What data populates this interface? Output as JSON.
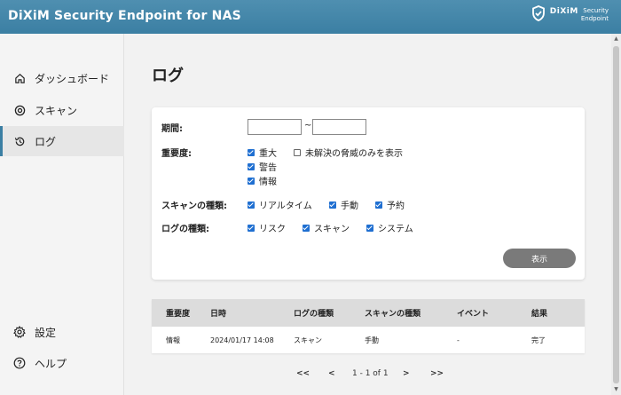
{
  "app": {
    "title": "DiXiM Security Endpoint for NAS"
  },
  "brand": {
    "name": "DiXiM",
    "sub1": "Security",
    "sub2": "Endpoint",
    "icon": "shield-check-icon"
  },
  "sidebar": {
    "items": [
      {
        "label": "ダッシュボード",
        "icon": "home-icon"
      },
      {
        "label": "スキャン",
        "icon": "scan-icon"
      },
      {
        "label": "ログ",
        "icon": "history-icon",
        "active": true
      }
    ],
    "bottom": [
      {
        "label": "設定",
        "icon": "gear-icon"
      },
      {
        "label": "ヘルプ",
        "icon": "help-icon"
      }
    ]
  },
  "main": {
    "title": "ログ"
  },
  "filter": {
    "period_label": "期間:",
    "period_from": "",
    "period_to": "",
    "period_sep": "~",
    "severity_label": "重要度:",
    "severity": [
      {
        "label": "重大",
        "checked": true
      },
      {
        "label": "警告",
        "checked": true
      },
      {
        "label": "情報",
        "checked": true
      }
    ],
    "unresolved": {
      "label": "未解決の脅威のみを表示",
      "checked": false
    },
    "scan_type_label": "スキャンの種類:",
    "scan_types": [
      {
        "label": "リアルタイム",
        "checked": true
      },
      {
        "label": "手動",
        "checked": true
      },
      {
        "label": "予約",
        "checked": true
      }
    ],
    "log_type_label": "ログの種類:",
    "log_types": [
      {
        "label": "リスク",
        "checked": true
      },
      {
        "label": "スキャン",
        "checked": true
      },
      {
        "label": "システム",
        "checked": true
      }
    ],
    "show_button": "表示"
  },
  "table": {
    "headers": [
      "重要度",
      "日時",
      "ログの種類",
      "スキャンの種類",
      "イベント",
      "結果"
    ],
    "rows": [
      [
        "情報",
        "2024/01/17 14:08",
        "スキャン",
        "手動",
        "-",
        "完了"
      ]
    ]
  },
  "pager": {
    "first": "<<",
    "prev": "<",
    "info": "1 - 1 of 1",
    "next": ">",
    "last": ">>"
  },
  "colors": {
    "topbar": "#3b7fa3",
    "checkbox": "#1f6fd1",
    "button": "#7a7a7a"
  }
}
